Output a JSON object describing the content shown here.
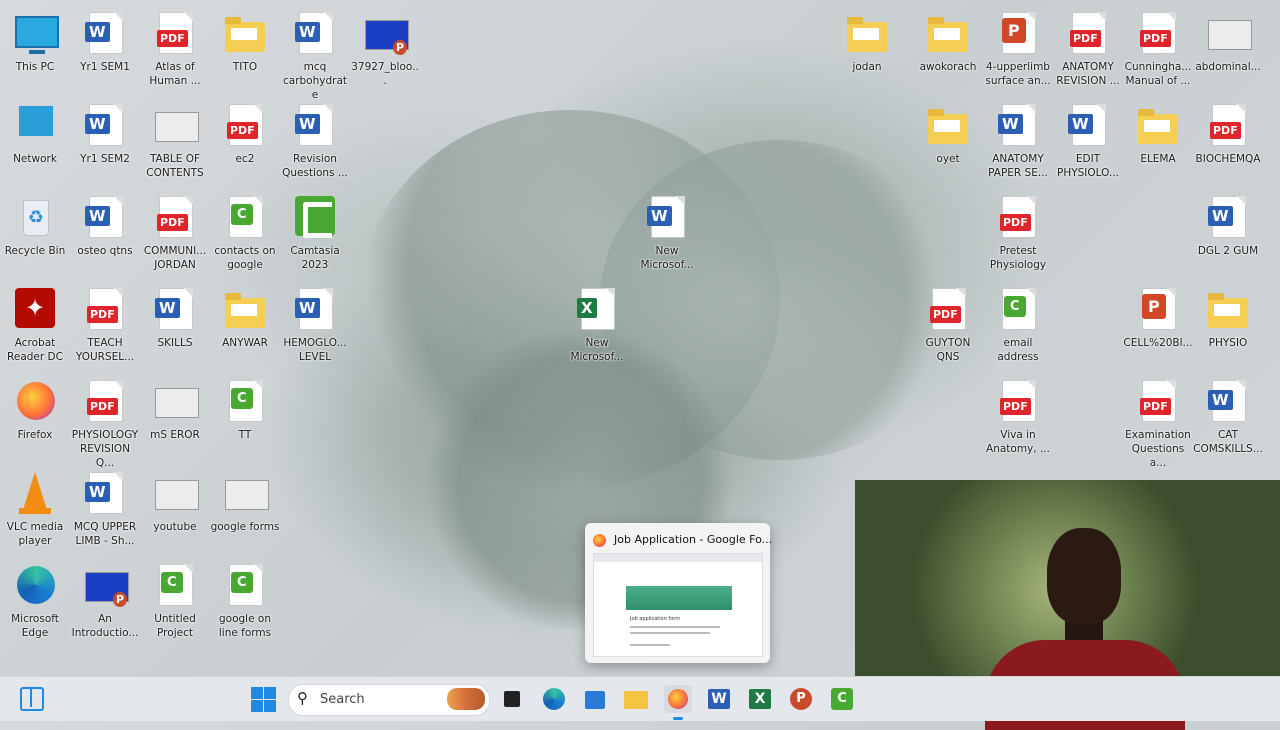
{
  "desktop": {
    "left_icons": [
      {
        "label": "This PC",
        "kind": "pc"
      },
      {
        "label": "Yr1 SEM1",
        "kind": "word"
      },
      {
        "label": "Atlas of Human ...",
        "kind": "pdf"
      },
      {
        "label": "TITO",
        "kind": "folder"
      },
      {
        "label": "mcq carbohydrate",
        "kind": "word"
      },
      {
        "label": "37927_bloo...",
        "kind": "ppt-thumb"
      },
      {
        "label": "Network",
        "kind": "network"
      },
      {
        "label": "Yr1 SEM2",
        "kind": "word"
      },
      {
        "label": "TABLE OF CONTENTS",
        "kind": "thumb"
      },
      {
        "label": "ec2",
        "kind": "pdf"
      },
      {
        "label": "Revision Questions ...",
        "kind": "word"
      },
      {
        "label": "Recycle Bin",
        "kind": "bin"
      },
      {
        "label": "osteo qtns",
        "kind": "word"
      },
      {
        "label": "COMMUNI... JORDAN",
        "kind": "pdf"
      },
      {
        "label": "contacts on google",
        "kind": "camtasia-file"
      },
      {
        "label": "Camtasia 2023",
        "kind": "camtasia"
      },
      {
        "label": "Acrobat Reader DC",
        "kind": "acrobat"
      },
      {
        "label": "TEACH YOURSEL...",
        "kind": "pdf"
      },
      {
        "label": "SKILLS",
        "kind": "word"
      },
      {
        "label": "ANYWAR",
        "kind": "folder"
      },
      {
        "label": "HEMOGLO... LEVEL",
        "kind": "word"
      },
      {
        "label": "Firefox",
        "kind": "firefox"
      },
      {
        "label": "PHYSIOLOGY REVISION Q...",
        "kind": "pdf"
      },
      {
        "label": "mS EROR",
        "kind": "thumb"
      },
      {
        "label": "TT",
        "kind": "camtasia-file"
      },
      {
        "label": "VLC media player",
        "kind": "vlc"
      },
      {
        "label": "MCQ UPPER LIMB - Sh...",
        "kind": "word"
      },
      {
        "label": "youtube",
        "kind": "thumb"
      },
      {
        "label": "google forms",
        "kind": "thumb"
      },
      {
        "label": "Microsoft Edge",
        "kind": "edge"
      },
      {
        "label": "An Introductio...",
        "kind": "ppt-thumb"
      },
      {
        "label": "Untitled Project",
        "kind": "camtasia-file"
      },
      {
        "label": "google on line forms",
        "kind": "camtasia-file"
      }
    ],
    "center_icons": [
      {
        "label": "New Microsof...",
        "kind": "word"
      },
      {
        "label": "New Microsof...",
        "kind": "excel"
      }
    ],
    "right_icons": [
      {
        "label": "jodan",
        "kind": "folder"
      },
      {
        "label": "awokorach",
        "kind": "folder"
      },
      {
        "label": "4-upperlimb surface an...",
        "kind": "ppt"
      },
      {
        "label": "ANATOMY REVISION ...",
        "kind": "pdf"
      },
      {
        "label": "Cunningha... Manual of ...",
        "kind": "pdf"
      },
      {
        "label": "abdominal...",
        "kind": "thumb"
      },
      {
        "label": "oyet",
        "kind": "folder"
      },
      {
        "label": "ANATOMY PAPER SE...",
        "kind": "word"
      },
      {
        "label": "EDIT PHYSIOLO...",
        "kind": "word"
      },
      {
        "label": "ELEMA",
        "kind": "folder"
      },
      {
        "label": "BIOCHEMQA",
        "kind": "pdf"
      },
      {
        "label": "Pretest Physiology",
        "kind": "pdf"
      },
      {
        "label": "DGL 2 GUM",
        "kind": "word"
      },
      {
        "label": "GUYTON QNS",
        "kind": "pdf"
      },
      {
        "label": "email address",
        "kind": "camtasia-file"
      },
      {
        "label": "CELL%20Bl...",
        "kind": "ppt"
      },
      {
        "label": "PHYSIO",
        "kind": "folder"
      },
      {
        "label": "Viva in Anatomy, ...",
        "kind": "pdf"
      },
      {
        "label": "Examination Questions a...",
        "kind": "pdf"
      },
      {
        "label": "CAT COMSKILLS...",
        "kind": "word"
      }
    ]
  },
  "icons_text": {
    "word": "W",
    "pdf": "PDF",
    "excel": "X",
    "camtasia": "C",
    "ppt": "P"
  },
  "popup": {
    "title": "Job Application - Google Fo...",
    "preview_title": "Job application form"
  },
  "taskbar": {
    "search_placeholder": "Search",
    "apps": [
      "widgets",
      "start",
      "search",
      "task-view",
      "edge",
      "store",
      "file-explorer",
      "firefox",
      "word",
      "excel",
      "powerpoint",
      "camtasia"
    ]
  },
  "colors": {
    "accent": "#1f8ae6",
    "word": "#2b5fb4",
    "pdf": "#e0242b",
    "excel": "#1f7a44",
    "camtasia": "#49a832"
  }
}
